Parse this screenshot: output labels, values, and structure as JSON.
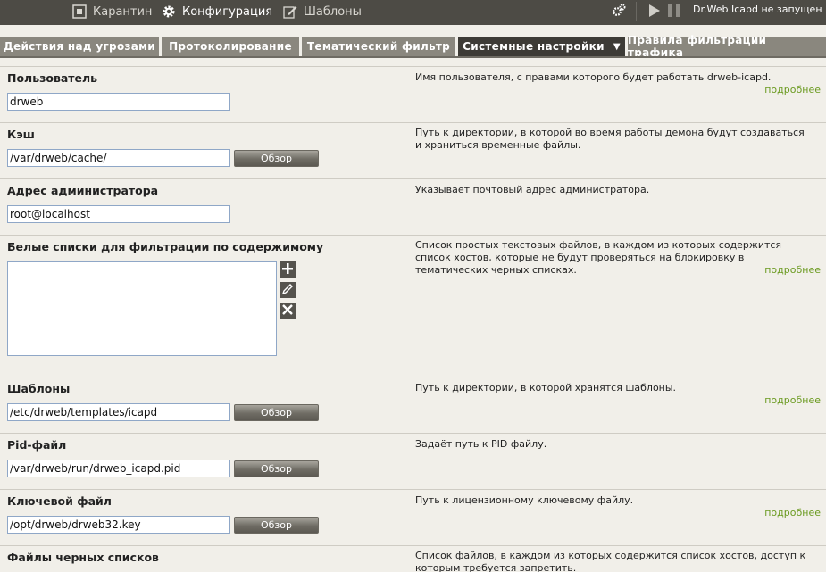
{
  "topbar": {
    "items": [
      {
        "label": "Карантин",
        "icon": "quarantine-icon"
      },
      {
        "label": "Конфигурация",
        "icon": "gear-icon"
      },
      {
        "label": "Шаблоны",
        "icon": "pencil-icon"
      }
    ],
    "status": "Dr.Web Icapd не запущен"
  },
  "tabs": [
    {
      "label": "Действия над угрозами"
    },
    {
      "label": "Протоколирование"
    },
    {
      "label": "Тематический фильтр"
    },
    {
      "label": "Системные настройки",
      "arrow": "▼"
    },
    {
      "label": "Правила фильтрации трафика"
    }
  ],
  "common": {
    "more": "подробнее",
    "browse": "Обзор"
  },
  "settings": {
    "user": {
      "title": "Пользователь",
      "value": "drweb",
      "desc": "Имя пользователя, с правами которого будет работать drweb-icapd."
    },
    "cache": {
      "title": "Кэш",
      "value": "/var/drweb/cache/",
      "desc": "Путь к директории, в которой во время работы демона будут создаваться и храниться временные файлы."
    },
    "admin": {
      "title": "Адрес администратора",
      "value": "root@localhost",
      "desc": "Указывает почтовый адрес администратора."
    },
    "whitelists": {
      "title": "Белые списки для фильтрации по содержимому",
      "desc": "Список простых текстовых файлов, в каждом из которых содержится список хостов, которые не будут проверяться на блокировку в тематических черных списках."
    },
    "templates": {
      "title": "Шаблоны",
      "value": "/etc/drweb/templates/icapd",
      "desc": "Путь к директории, в которой хранятся шаблоны."
    },
    "pid": {
      "title": "Pid-файл",
      "value": "/var/drweb/run/drweb_icapd.pid",
      "desc": "Задаёт путь к PID файлу."
    },
    "key": {
      "title": "Ключевой файл",
      "value": "/opt/drweb/drweb32.key",
      "desc": "Путь к лицензионному ключевому файлу."
    },
    "blacklists": {
      "title": "Файлы черных списков",
      "desc": "Список файлов, в каждом из которых содержится список хостов, доступ к которым требуется запретить."
    }
  }
}
